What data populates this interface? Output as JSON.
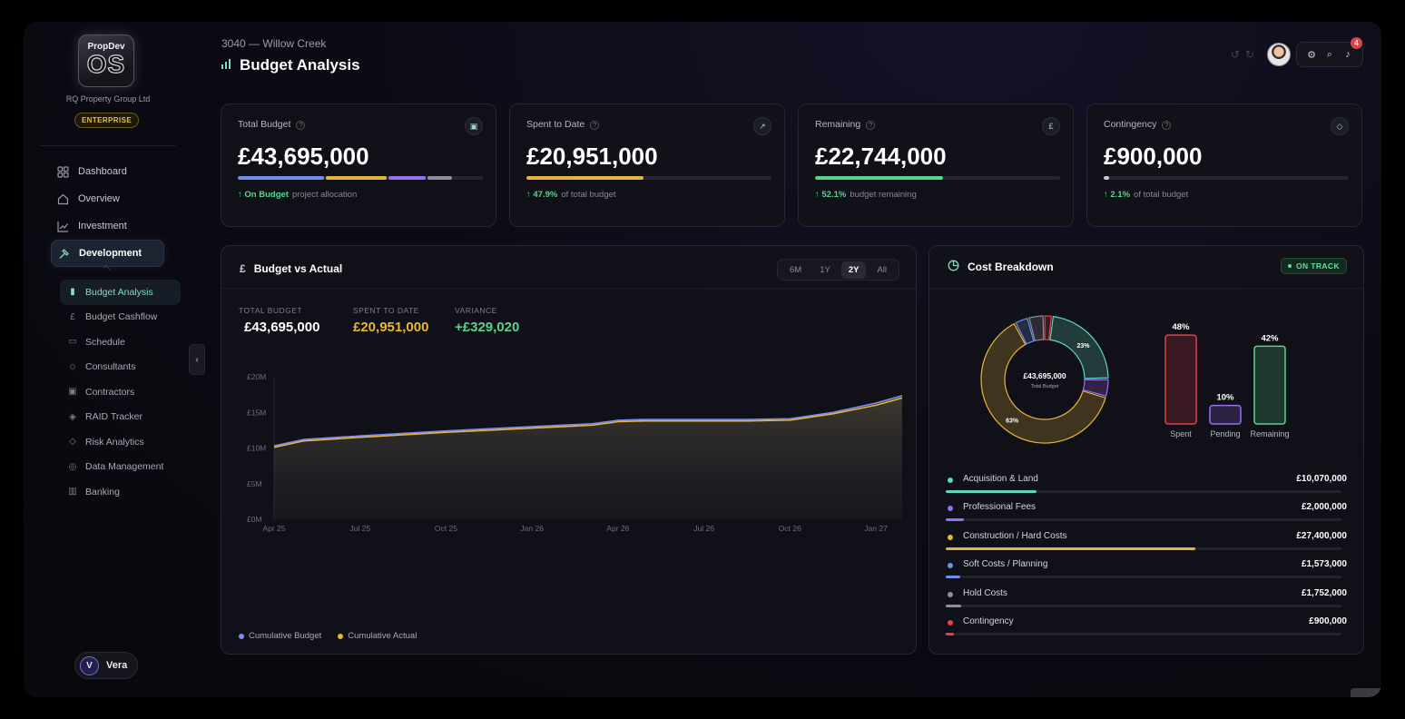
{
  "brand": {
    "logo_small": "PropDev",
    "logo_big": "OS",
    "company": "RQ Property Group Ltd",
    "tier": "ENTERPRISE"
  },
  "nav": [
    {
      "label": "Dashboard",
      "icon": "grid-icon"
    },
    {
      "label": "Overview",
      "icon": "home-icon"
    },
    {
      "label": "Investment",
      "icon": "trend-line-icon"
    },
    {
      "label": "Development",
      "icon": "hammer-icon",
      "active": true
    }
  ],
  "subnav": [
    {
      "label": "Budget Analysis",
      "icon": "bar-chart-icon",
      "active": true
    },
    {
      "label": "Budget Cashflow",
      "icon": "pound-icon"
    },
    {
      "label": "Schedule",
      "icon": "calendar-icon"
    },
    {
      "label": "Consultants",
      "icon": "users-icon"
    },
    {
      "label": "Contractors",
      "icon": "briefcase-icon"
    },
    {
      "label": "RAID Tracker",
      "icon": "shield-check-icon"
    },
    {
      "label": "Risk Analytics",
      "icon": "shield-icon"
    },
    {
      "label": "Data Management",
      "icon": "database-icon"
    },
    {
      "label": "Banking",
      "icon": "bank-icon"
    }
  ],
  "user": {
    "initial": "V",
    "name": "Vera"
  },
  "header": {
    "breadcrumb": "3040 — Willow Creek",
    "title": "Budget Analysis",
    "notifications": "4"
  },
  "kpis": [
    {
      "label": "Total Budget",
      "value": "£43,695,000",
      "delta": "On Budget",
      "note": "project allocation",
      "icon": "briefcase-icon",
      "segments": [
        {
          "color": "#6f8fe8",
          "share": 35
        },
        {
          "color": "#e8b637",
          "share": 25
        },
        {
          "color": "#9a6ff0",
          "share": 15
        },
        {
          "color": "#8f8f9a",
          "share": 10
        }
      ]
    },
    {
      "label": "Spent to Date",
      "value": "£20,951,000",
      "delta": "47.9%",
      "note": "of total budget",
      "icon": "trend-up-icon",
      "segments": [
        {
          "color": "#e8b637",
          "share": 47.9
        }
      ]
    },
    {
      "label": "Remaining",
      "value": "£22,744,000",
      "delta": "52.1%",
      "note": "budget remaining",
      "icon": "pound-icon",
      "segments": [
        {
          "color": "#58d58b",
          "share": 52.1
        }
      ]
    },
    {
      "label": "Contingency",
      "value": "£900,000",
      "delta": "2.1%",
      "note": "of total budget",
      "icon": "shield-icon",
      "segments": [
        {
          "color": "#c8c8d0",
          "share": 2.1
        }
      ]
    }
  ],
  "bva": {
    "title": "Budget vs Actual",
    "ranges": [
      "6M",
      "1Y",
      "2Y",
      "All"
    ],
    "active_range": "2Y",
    "stats": [
      {
        "label": "TOTAL BUDGET",
        "value": "£43,695,000",
        "color": "#ffffff"
      },
      {
        "label": "SPENT TO DATE",
        "value": "£20,951,000",
        "color": "#e8b637"
      },
      {
        "label": "VARIANCE",
        "value": "+£329,020",
        "color": "#58d58b"
      }
    ],
    "legend": [
      {
        "name": "Cumulative Budget",
        "color": "#7f8ef0"
      },
      {
        "name": "Cumulative Actual",
        "color": "#e8b637"
      }
    ]
  },
  "chart_data": [
    {
      "type": "line",
      "x_ticks": [
        "Apr 25",
        "Jul 25",
        "Oct 25",
        "Jan 26",
        "Apr 26",
        "Jul 26",
        "Oct 26",
        "Jan 27"
      ],
      "y_ticks": [
        "£0M",
        "£5M",
        "£10M",
        "£15M",
        "£20M"
      ],
      "ylim": [
        0,
        20
      ],
      "x": [
        0,
        0.35,
        1,
        2,
        3,
        3.7,
        3.95,
        4,
        4.3,
        5,
        5.5,
        6,
        6.5,
        7,
        7.5,
        7.8
      ],
      "series": [
        {
          "name": "Cumulative Budget",
          "color": "#7f8ef0",
          "values": [
            10.3,
            11.2,
            11.7,
            12.4,
            13.0,
            13.4,
            13.8,
            13.9,
            14.0,
            14.0,
            14.0,
            14.1,
            15.0,
            16.3,
            18.0,
            19.3
          ]
        },
        {
          "name": "Cumulative Actual",
          "color": "#e8b637",
          "values": [
            10.1,
            11.0,
            11.5,
            12.2,
            12.8,
            13.2,
            13.6,
            13.7,
            13.8,
            13.8,
            13.8,
            13.9,
            14.8,
            16.0,
            17.7,
            19.0
          ]
        }
      ],
      "grid": false
    },
    {
      "type": "pie",
      "center_value": "£43,695,000",
      "center_label": "Total Budget",
      "slices": [
        {
          "name": "Acquisition & Land",
          "value": 23,
          "color": "#5fd6b8",
          "label": "23%"
        },
        {
          "name": "Professional Fees",
          "value": 4.6,
          "color": "#9a6ff0"
        },
        {
          "name": "Construction / Hard Costs",
          "value": 63,
          "color": "#e8b637",
          "label": "63%"
        },
        {
          "name": "Soft Costs / Planning",
          "value": 3.6,
          "color": "#6f8fe8"
        },
        {
          "name": "Hold Costs",
          "value": 4.0,
          "color": "#8f8f9a"
        },
        {
          "name": "Contingency",
          "value": 2.1,
          "color": "#e0414b"
        }
      ]
    },
    {
      "type": "bar",
      "categories": [
        "Spent",
        "Pending",
        "Remaining"
      ],
      "values": [
        48,
        10,
        42
      ],
      "labels": [
        "48%",
        "10%",
        "42%"
      ],
      "colors": [
        "#e0414b",
        "#9a6ff0",
        "#58d58b"
      ],
      "ylim": [
        0,
        50
      ]
    }
  ],
  "cost_breakdown": {
    "title": "Cost Breakdown",
    "status": "ON TRACK",
    "items": [
      {
        "name": "Acquisition & Land",
        "value": "£10,070,000",
        "color": "#5fd6b8",
        "share": 23
      },
      {
        "name": "Professional Fees",
        "value": "£2,000,000",
        "color": "#9a6ff0",
        "share": 4.6
      },
      {
        "name": "Construction / Hard Costs",
        "value": "£27,400,000",
        "color": "#e8b637",
        "share": 63
      },
      {
        "name": "Soft Costs / Planning",
        "value": "£1,573,000",
        "color": "#6f8fe8",
        "share": 3.6
      },
      {
        "name": "Hold Costs",
        "value": "£1,752,000",
        "color": "#8f8f9a",
        "share": 4.0
      },
      {
        "name": "Contingency",
        "value": "£900,000",
        "color": "#e0414b",
        "share": 2.1
      }
    ]
  }
}
